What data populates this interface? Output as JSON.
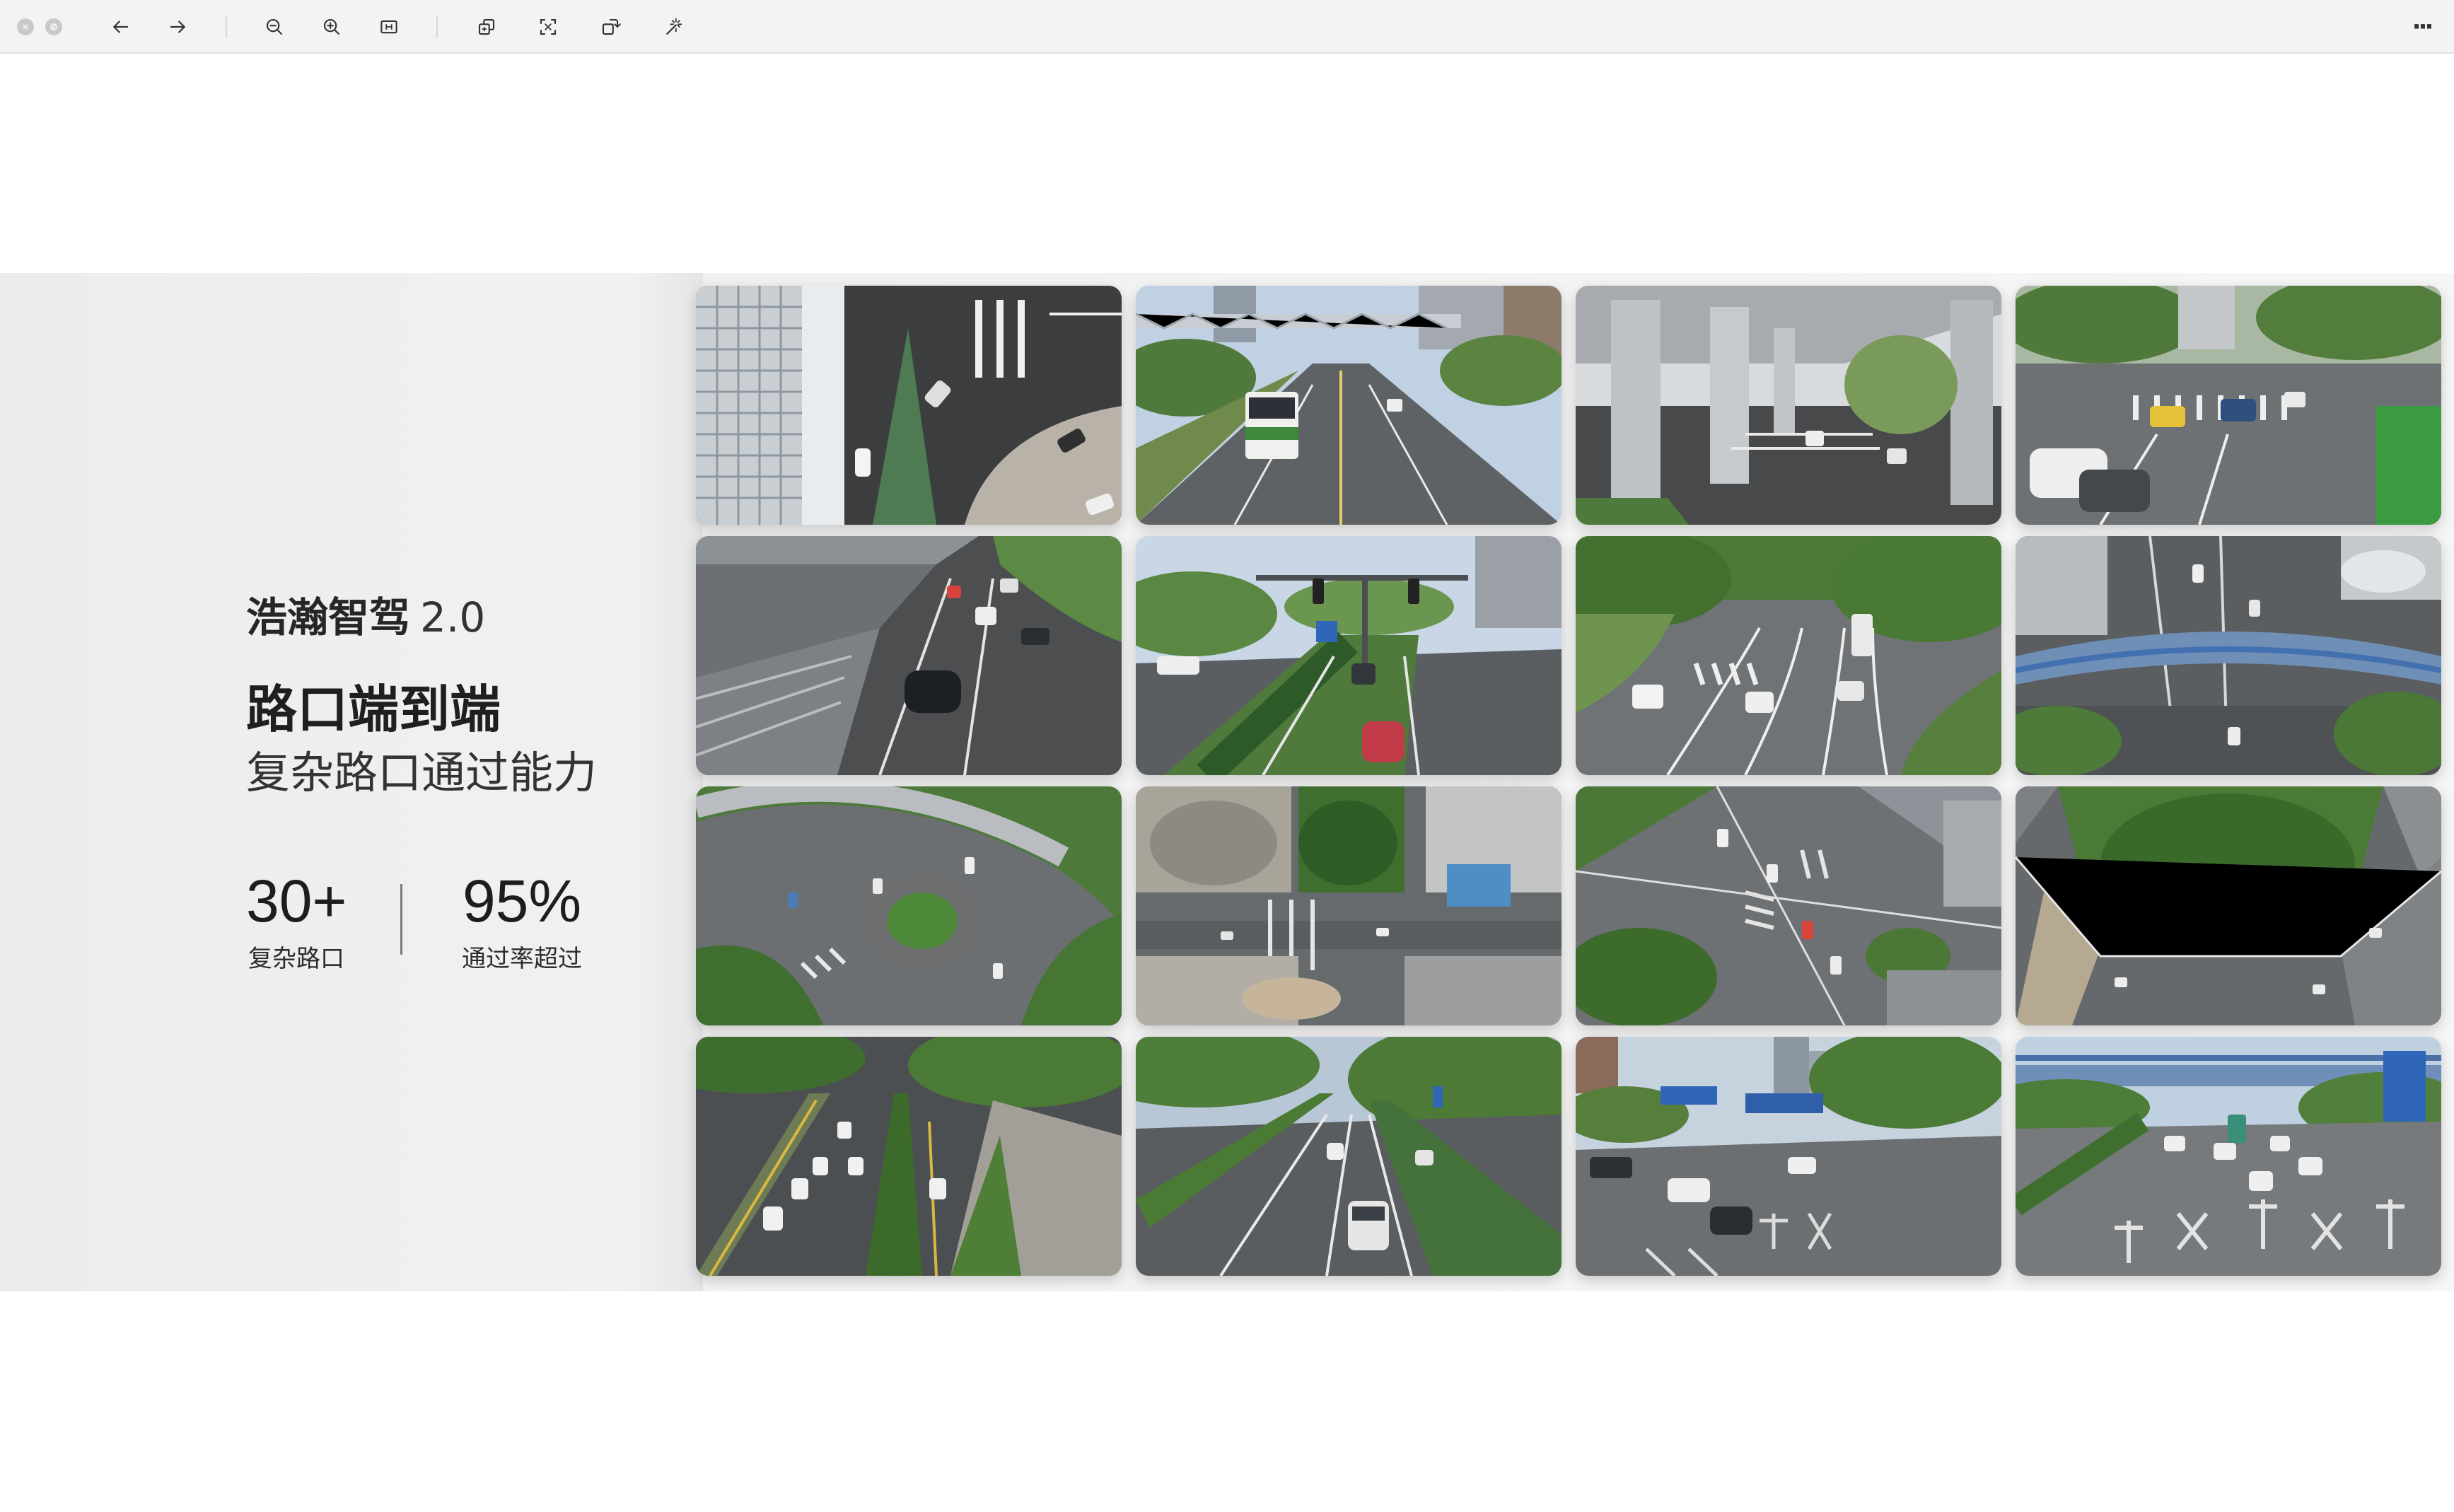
{
  "window": {
    "controls": [
      "close-icon",
      "minimize-icon"
    ]
  },
  "toolbar": {
    "buttons": [
      {
        "name": "back-icon"
      },
      {
        "name": "forward-icon"
      },
      {
        "name": "zoom-out-icon"
      },
      {
        "name": "zoom-in-icon"
      },
      {
        "name": "fit-page-icon"
      },
      {
        "name": "copy-icon"
      },
      {
        "name": "crop-icon"
      },
      {
        "name": "rotate-icon"
      },
      {
        "name": "magic-wand-icon"
      },
      {
        "name": "more-icon"
      }
    ],
    "more_label": "···"
  },
  "slide": {
    "brand": "浩瀚智驾",
    "version": "2.0",
    "headline": "路口端到端",
    "subline": "复杂路口通过能力",
    "stats": [
      {
        "value": "30+",
        "label": "复杂路口"
      },
      {
        "value": "95%",
        "label": "通过率超过"
      }
    ]
  },
  "gallery": {
    "tiles": [
      {
        "scene": "aerial-corner-building"
      },
      {
        "scene": "street-bus-overpass"
      },
      {
        "scene": "under-viaduct-road"
      },
      {
        "scene": "intersection-crosswalk"
      },
      {
        "scene": "road-beside-elevated"
      },
      {
        "scene": "traffic-lights-avenue"
      },
      {
        "scene": "curved-intersection"
      },
      {
        "scene": "aerial-pedestrian-bridge"
      },
      {
        "scene": "aerial-roundabout"
      },
      {
        "scene": "aerial-park-crossing"
      },
      {
        "scene": "aerial-city-junction"
      },
      {
        "scene": "aerial-green-corner"
      },
      {
        "scene": "avenue-tree-median"
      },
      {
        "scene": "boulevard-suv"
      },
      {
        "scene": "city-road-markings"
      },
      {
        "scene": "road-text-markings"
      }
    ]
  }
}
